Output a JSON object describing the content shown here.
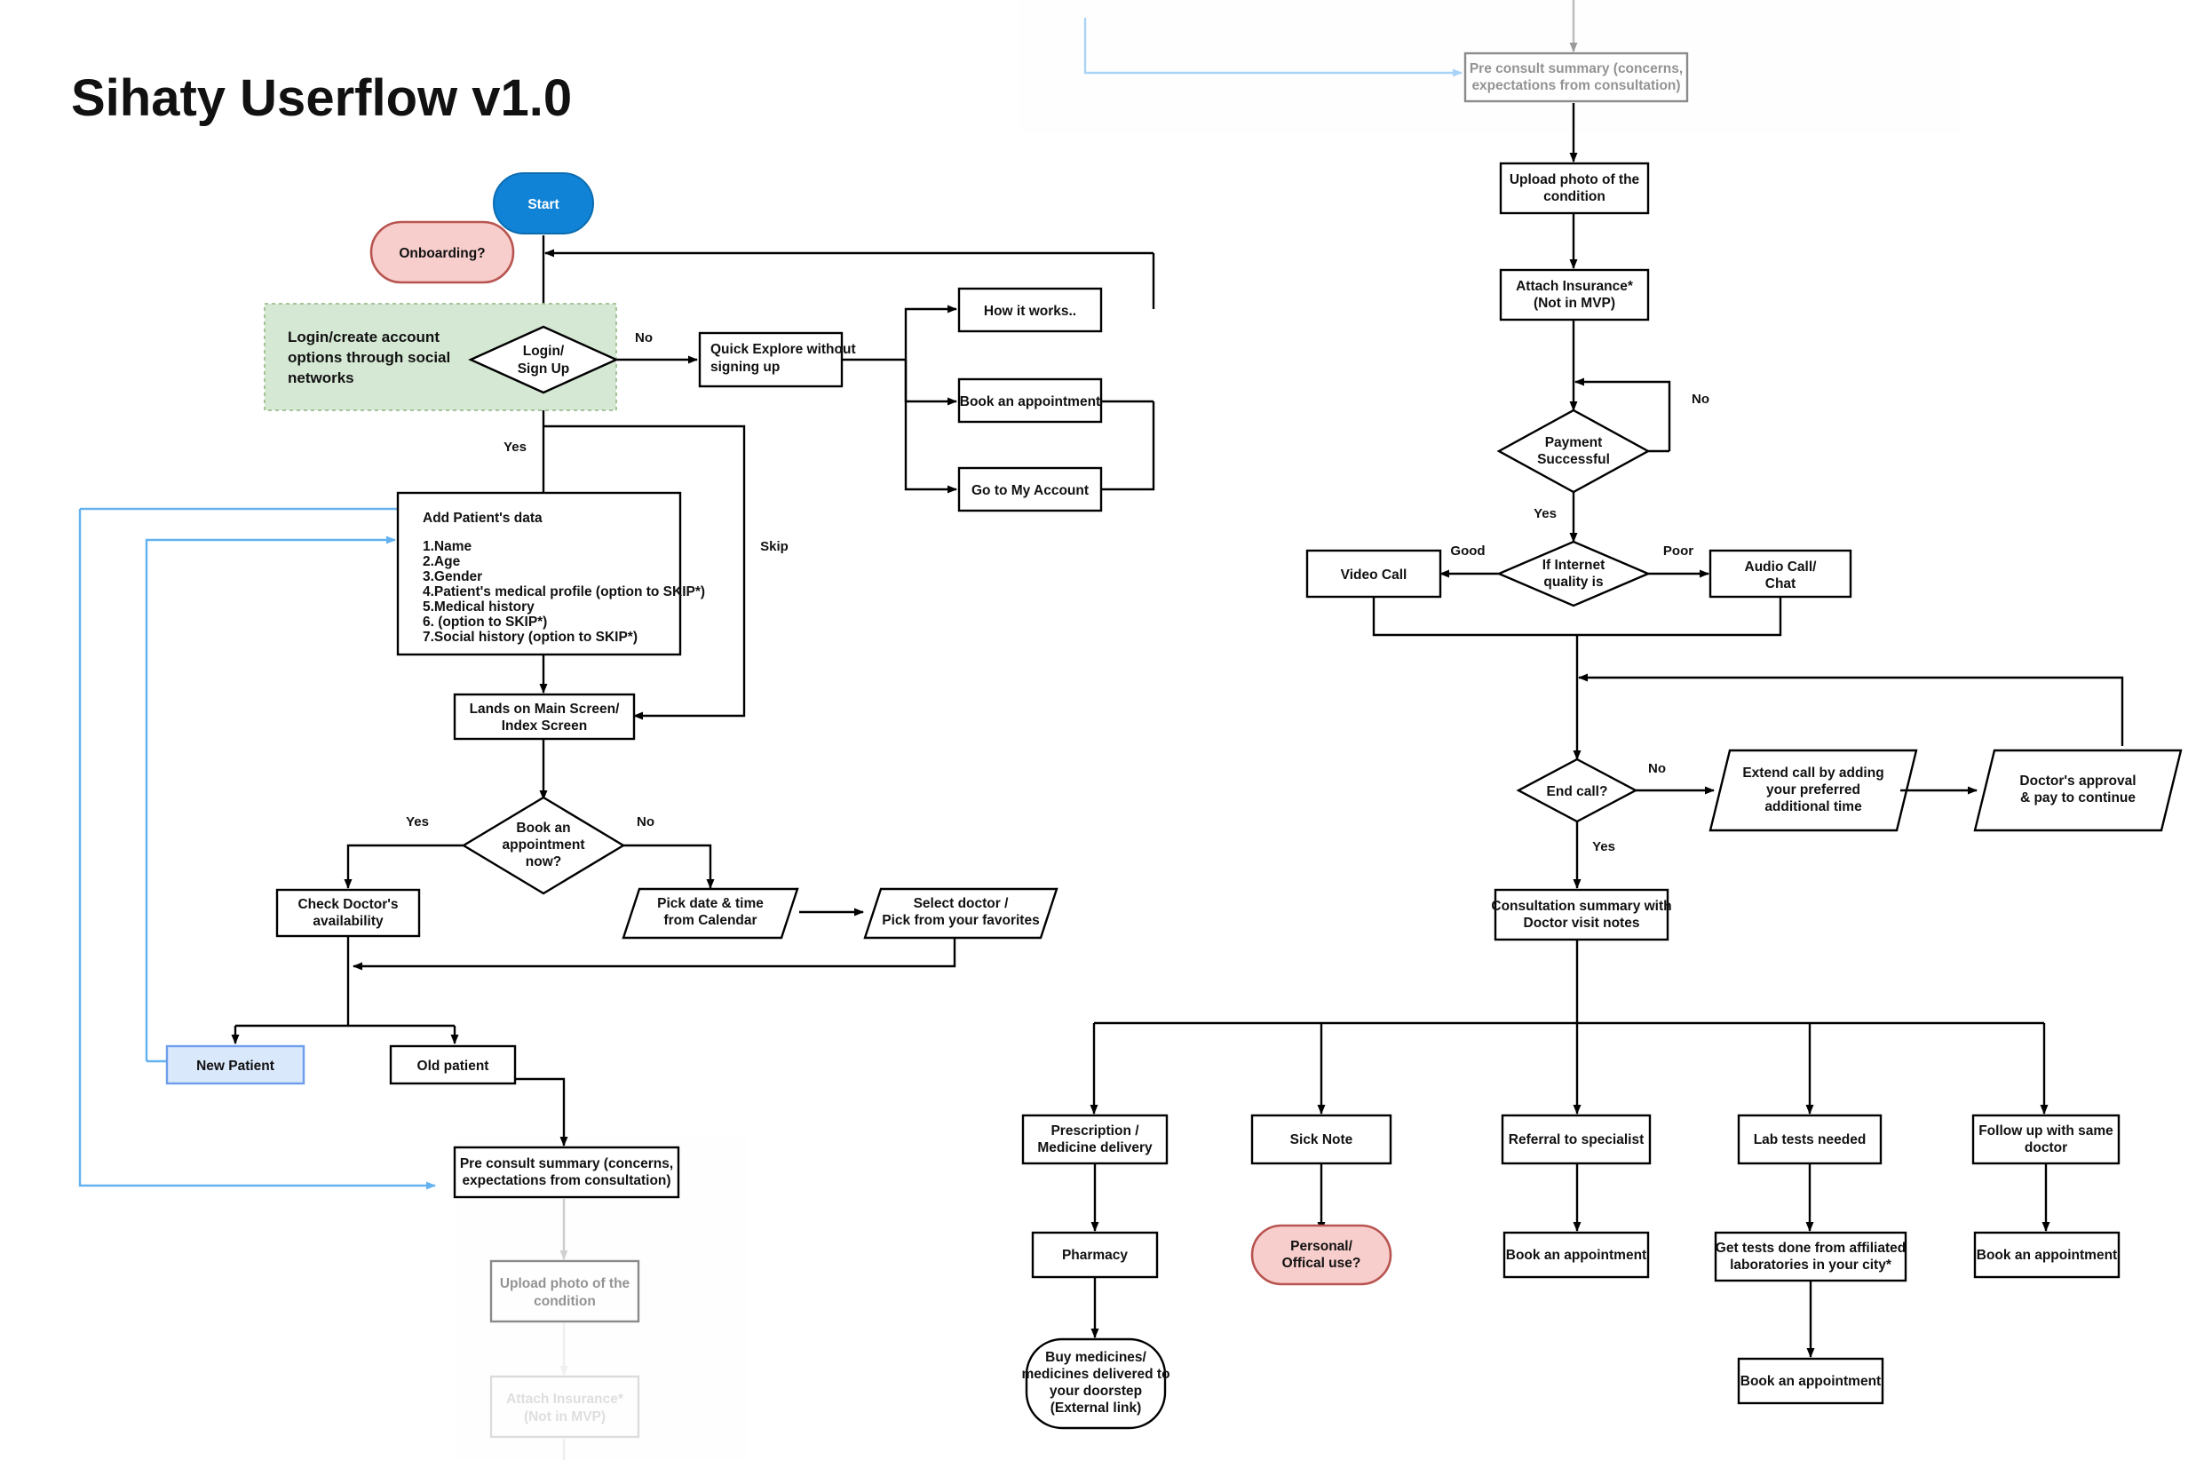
{
  "title": "Sihaty Userflow v1.0",
  "colors": {
    "start_fill": "#1183d6",
    "onboarding_fill": "#f8cecc",
    "onboarding_stroke": "#b85450",
    "note_fill": "#d5e8d4",
    "note_stroke": "#82b366",
    "new_patient_fill": "#dae8fc",
    "new_patient_stroke": "#6c9eeb",
    "blue_link": "#64b1f0",
    "default_stroke": "#000000"
  },
  "nodes": {
    "start": "Start",
    "onboarding": "Onboarding?",
    "login_note": "Login/create account options through social networks",
    "login_signup": "Login/\nSign Up",
    "quick_explore": "Quick Explore without signing up",
    "how_it_works": "How it works..",
    "book_appointment_explore": "Book an appointment",
    "go_to_my_account": "Go to My Account",
    "add_patient_title": "Add Patient's data",
    "add_patient_items": [
      "1.Name",
      "2.Age",
      "3.Gender",
      "4.Patient's medical profile (option to SKIP*)",
      "5.Medical history",
      "6. (option to SKIP*)",
      "7.Social history (option to SKIP*)"
    ],
    "lands_main_screen": "Lands on Main Screen/ Index Screen",
    "book_now_decision": "Book an appointment now?",
    "check_availability": "Check Doctor's availability",
    "pick_date_time": "Pick date & time from Calendar",
    "select_doctor": "Select doctor / Pick from your favorites",
    "new_patient": "New Patient",
    "old_patient": "Old patient",
    "pre_consult_summary": "Pre consult summary (concerns, expectations from consultation)",
    "upload_photo": "Upload photo of the condition",
    "attach_insurance": "Attach Insurance* (Not in MVP)",
    "payment_successful": "Payment Successful",
    "video_call": "Video Call",
    "audio_call": "Audio Call/ Chat",
    "internet_quality": "If Internet quality is",
    "end_call": "End call?",
    "extend_call": "Extend call by adding your preferred additional time",
    "doctors_approval": "Doctor's approval & pay to continue",
    "consultation_summary": "Consultation summary with Doctor visit notes",
    "prescription": "Prescription / Medicine delivery",
    "sick_note": "Sick Note",
    "referral": "Referral to specialist",
    "lab_tests": "Lab tests needed",
    "follow_up": "Follow up with same doctor",
    "pharmacy": "Pharmacy",
    "personal_official": "Personal/ Offical use?",
    "book_appointment_referral": "Book an appointment",
    "get_tests": "Get tests done from affiliated laboratories in your city*",
    "book_appointment_follow": "Book an appointment",
    "book_appointment_lab": "Book an appointment",
    "buy_medicines": "Buy medicines/ medicines delivered to your doorstep (External link)"
  },
  "node_lines": {
    "login_signup": [
      "Login/",
      "Sign Up"
    ],
    "login_note": [
      "Login/create account",
      "options through social",
      "networks"
    ],
    "quick_explore": [
      "Quick Explore without",
      "signing up"
    ],
    "lands_main_screen": [
      "Lands on Main Screen/",
      "Index Screen"
    ],
    "book_now_decision": [
      "Book an",
      "appointment",
      "now?"
    ],
    "check_availability": [
      "Check Doctor's",
      "availability"
    ],
    "pick_date_time": [
      "Pick date & time",
      "from Calendar"
    ],
    "select_doctor": [
      "Select doctor /",
      "Pick from your favorites"
    ],
    "pre_consult_summary": [
      "Pre consult summary (concerns,",
      "expectations from consultation)"
    ],
    "upload_photo": [
      "Upload photo of the",
      "condition"
    ],
    "attach_insurance": [
      "Attach Insurance*",
      "(Not in MVP)"
    ],
    "payment_successful": [
      "Payment",
      "Successful"
    ],
    "audio_call": [
      "Audio Call/",
      "Chat"
    ],
    "internet_quality": [
      "If Internet",
      "quality is"
    ],
    "extend_call": [
      "Extend call by adding",
      "your preferred",
      "additional time"
    ],
    "doctors_approval": [
      "Doctor's approval",
      "& pay to continue"
    ],
    "consultation_summary": [
      "Consultation summary with",
      "Doctor visit notes"
    ],
    "prescription": [
      "Prescription /",
      "Medicine delivery"
    ],
    "follow_up": [
      "Follow up with same",
      "doctor"
    ],
    "personal_official": [
      "Personal/",
      "Offical use?"
    ],
    "get_tests": [
      "Get tests done from affiliated",
      "laboratories in your city*"
    ],
    "buy_medicines": [
      "Buy medicines/",
      "medicines delivered to",
      "your doorstep",
      "(External link)"
    ]
  },
  "edge_labels": {
    "no_login": "No",
    "yes_login": "Yes",
    "skip": "Skip",
    "yes_book": "Yes",
    "no_book": "No",
    "no_payment": "No",
    "yes_payment": "Yes",
    "good": "Good",
    "poor": "Poor",
    "no_endcall": "No",
    "yes_endcall": "Yes"
  }
}
